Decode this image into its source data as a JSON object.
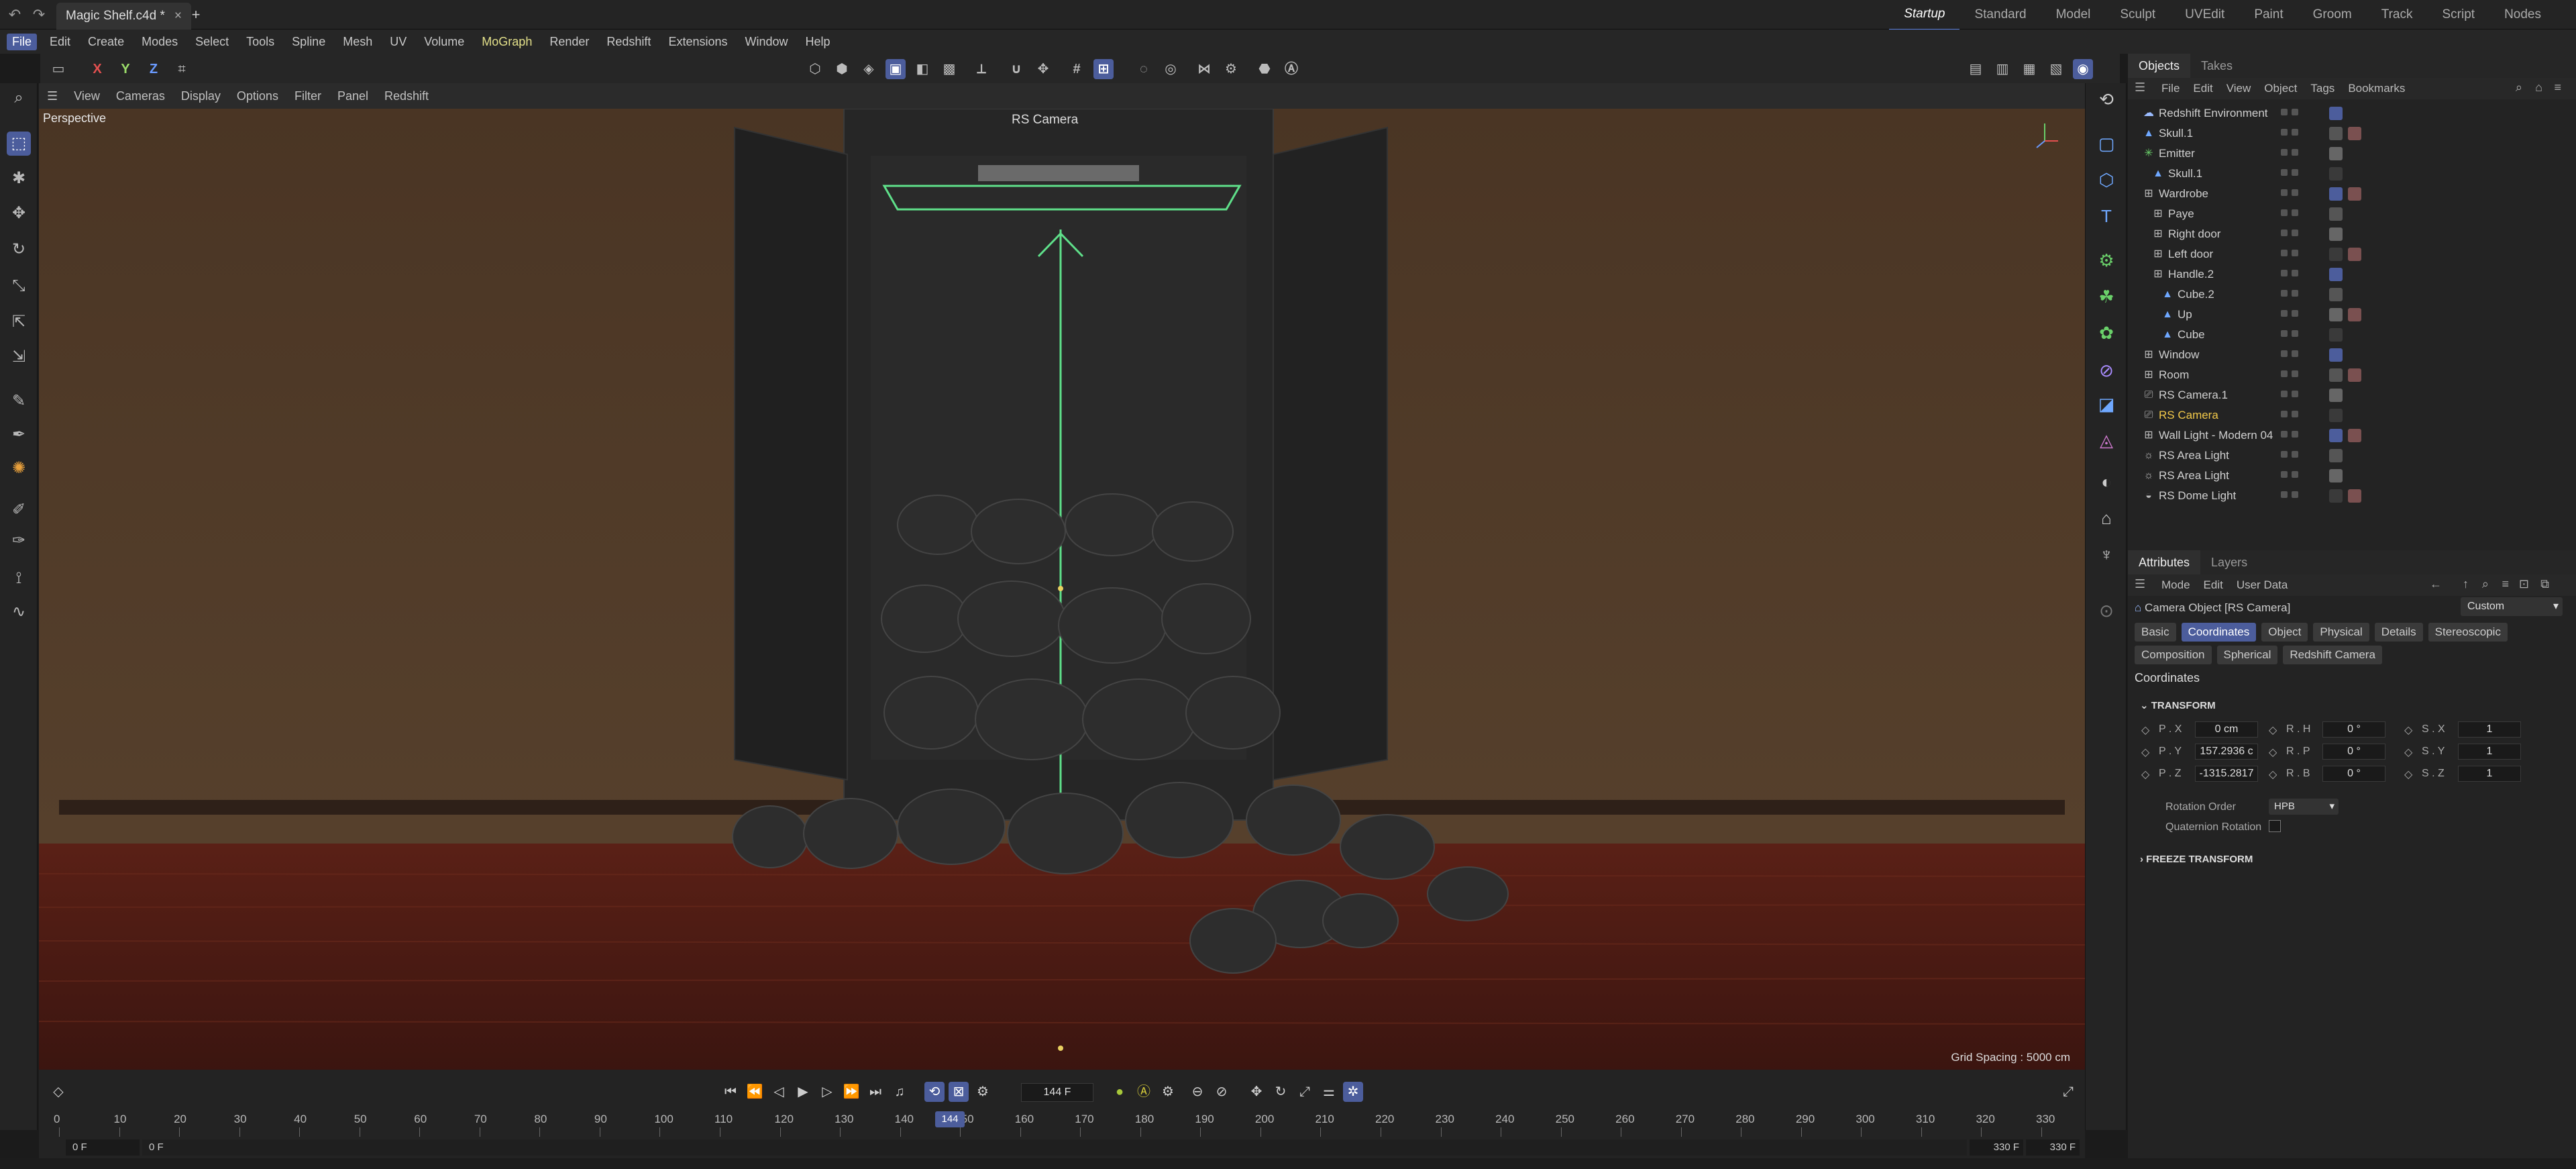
{
  "tabbar": {
    "doc_title": "Magic Shelf.c4d *",
    "close": "×",
    "add": "+",
    "layouts": [
      "Startup",
      "Standard",
      "Model",
      "Sculpt",
      "UVEdit",
      "Paint",
      "Groom",
      "Track",
      "Script",
      "Nodes"
    ],
    "active_layout": "Startup"
  },
  "menubar": {
    "items": [
      "File",
      "Edit",
      "Create",
      "Modes",
      "Select",
      "Tools",
      "Spline",
      "Mesh",
      "UV",
      "Volume",
      "MoGraph",
      "Render",
      "Redshift",
      "Extensions",
      "Window",
      "Help"
    ]
  },
  "toolbar": {
    "axis_x": "X",
    "axis_y": "Y",
    "axis_z": "Z"
  },
  "viewport": {
    "menu": [
      "View",
      "Cameras",
      "Display",
      "Options",
      "Filter",
      "Panel",
      "Redshift"
    ],
    "label": "Perspective",
    "camera_label": "RS Camera",
    "grid_spacing": "Grid Spacing : 5000 cm",
    "colors": {
      "wall": "#4d3826",
      "floor": "#4a1a12",
      "wardrobe": "#2a2a2a",
      "guide": "#5fe08a"
    }
  },
  "objects_panel": {
    "tabs": [
      "Objects",
      "Takes"
    ],
    "menu": [
      "File",
      "Edit",
      "View",
      "Object",
      "Tags",
      "Bookmarks"
    ],
    "rows": [
      {
        "name": "Redshift Environment",
        "indent": 0,
        "icon": "environment-icon"
      },
      {
        "name": "Skull.1",
        "indent": 0,
        "icon": "polygon-icon"
      },
      {
        "name": "Emitter",
        "indent": 0,
        "icon": "emitter-icon"
      },
      {
        "name": "Skull.1",
        "indent": 1,
        "icon": "polygon-icon"
      },
      {
        "name": "Wardrobe",
        "indent": 0,
        "icon": "null-icon"
      },
      {
        "name": "Paye",
        "indent": 1,
        "icon": "null-icon"
      },
      {
        "name": "Right door",
        "indent": 1,
        "icon": "null-icon"
      },
      {
        "name": "Left door",
        "indent": 1,
        "icon": "null-icon"
      },
      {
        "name": "Handle.2",
        "indent": 1,
        "icon": "null-icon"
      },
      {
        "name": "Cube.2",
        "indent": 2,
        "icon": "polygon-icon"
      },
      {
        "name": "Up",
        "indent": 2,
        "icon": "polygon-icon"
      },
      {
        "name": "Cube",
        "indent": 2,
        "icon": "polygon-icon"
      },
      {
        "name": "Window",
        "indent": 0,
        "icon": "null-icon"
      },
      {
        "name": "Room",
        "indent": 0,
        "icon": "null-icon"
      },
      {
        "name": "RS Camera.1",
        "indent": 0,
        "icon": "camera-icon"
      },
      {
        "name": "RS Camera",
        "indent": 0,
        "icon": "camera-icon",
        "highlight": true
      },
      {
        "name": "Wall Light - Modern 04",
        "indent": 0,
        "icon": "null-icon"
      },
      {
        "name": "RS Area Light",
        "indent": 0,
        "icon": "light-icon"
      },
      {
        "name": "RS Area Light",
        "indent": 0,
        "icon": "light-icon"
      },
      {
        "name": "RS Dome Light",
        "indent": 0,
        "icon": "dome-light-icon"
      }
    ]
  },
  "attributes_panel": {
    "tabs": [
      "Attributes",
      "Layers"
    ],
    "menu": [
      "Mode",
      "Edit",
      "User Data"
    ],
    "object_title": "Camera Object [RS Camera]",
    "preset": "Custom",
    "buttons_row1": [
      "Basic",
      "Coordinates",
      "Object",
      "Physical",
      "Details",
      "Stereoscopic"
    ],
    "buttons_row2": [
      "Composition",
      "Spherical",
      "Redshift Camera"
    ],
    "active_button": "Coordinates",
    "section_title": "Coordinates",
    "transform_header": "TRANSFORM",
    "freeze_header": "FREEZE TRANSFORM",
    "fields": {
      "px_label": "P . X",
      "px": "0 cm",
      "py_label": "P . Y",
      "py": "157.2936 c",
      "pz_label": "P . Z",
      "pz": "-1315.2817",
      "rh_label": "R . H",
      "rh": "0 °",
      "rp_label": "R . P",
      "rp": "0 °",
      "rb_label": "R . B",
      "rb": "0 °",
      "sx_label": "S . X",
      "sx": "1",
      "sy_label": "S . Y",
      "sy": "1",
      "sz_label": "S . Z",
      "sz": "1"
    },
    "rotation_order_label": "Rotation Order",
    "rotation_order": "HPB",
    "quaternion_label": "Quaternion Rotation"
  },
  "timeline": {
    "current_frame": "144 F",
    "playhead_label": "144",
    "ticks": [
      "0",
      "10",
      "20",
      "30",
      "40",
      "50",
      "60",
      "70",
      "80",
      "90",
      "100",
      "110",
      "120",
      "130",
      "140",
      "150",
      "160",
      "170",
      "180",
      "190",
      "200",
      "210",
      "220",
      "230",
      "240",
      "250",
      "260",
      "270",
      "280",
      "290",
      "300",
      "310",
      "320",
      "330"
    ],
    "start": "0 F",
    "start2": "0 F",
    "end": "330 F",
    "end2": "330 F"
  }
}
